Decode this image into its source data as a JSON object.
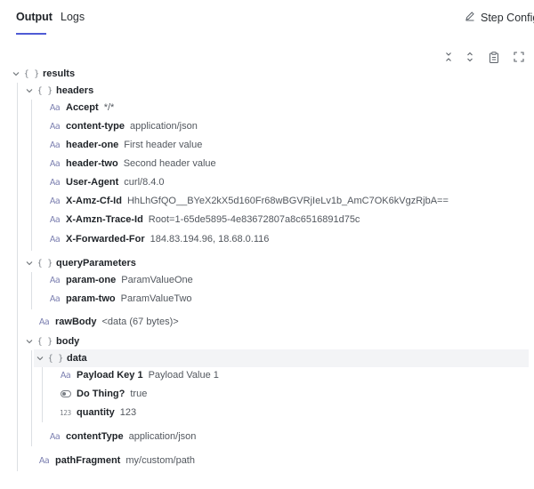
{
  "tabs": [
    {
      "label": "Output",
      "active": true
    },
    {
      "label": "Logs",
      "active": false
    }
  ],
  "step_config_label": "Step Config",
  "toolbar_icons": [
    "collapse-all-icon",
    "expand-all-icon",
    "clipboard-icon",
    "fullscreen-icon"
  ],
  "tree": {
    "results": {
      "key": "results"
    },
    "headers": {
      "key": "headers"
    },
    "accept": {
      "key": "Accept",
      "value": "*/*"
    },
    "content_type": {
      "key": "content-type",
      "value": "application/json"
    },
    "header_one": {
      "key": "header-one",
      "value": "First header value"
    },
    "header_two": {
      "key": "header-two",
      "value": "Second header value"
    },
    "user_agent": {
      "key": "User-Agent",
      "value": "curl/8.4.0"
    },
    "amz_cf_id": {
      "key": "X-Amz-Cf-Id",
      "value": "HhLhGfQO__BYeX2kX5d160Fr68wBGVRjIeLv1b_AmC7OK6kVgzRjbA=="
    },
    "amzn_trace_id": {
      "key": "X-Amzn-Trace-Id",
      "value": "Root=1-65de5895-4e83672807a8c6516891d75c"
    },
    "forwarded_for": {
      "key": "X-Forwarded-For",
      "value": "184.83.194.96, 18.68.0.116"
    },
    "query_parameters": {
      "key": "queryParameters"
    },
    "param_one": {
      "key": "param-one",
      "value": "ParamValueOne"
    },
    "param_two": {
      "key": "param-two",
      "value": "ParamValueTwo"
    },
    "raw_body": {
      "key": "rawBody",
      "value": "<data (67 bytes)>"
    },
    "body": {
      "key": "body"
    },
    "data": {
      "key": "data"
    },
    "payload_key_1": {
      "key": "Payload Key 1",
      "value": "Payload Value 1"
    },
    "do_thing": {
      "key": "Do Thing?",
      "value": "true"
    },
    "quantity": {
      "key": "quantity",
      "value": "123"
    },
    "content_type_body": {
      "key": "contentType",
      "value": "application/json"
    },
    "path_fragment": {
      "key": "pathFragment",
      "value": "my/custom/path"
    }
  },
  "icon_glyphs": {
    "object": "{ }",
    "text": "Aa",
    "number": "123"
  },
  "colors": {
    "accent": "#4f5bd5",
    "highlight_row": "#f3f4f6",
    "guide": "#dcdfe3"
  }
}
